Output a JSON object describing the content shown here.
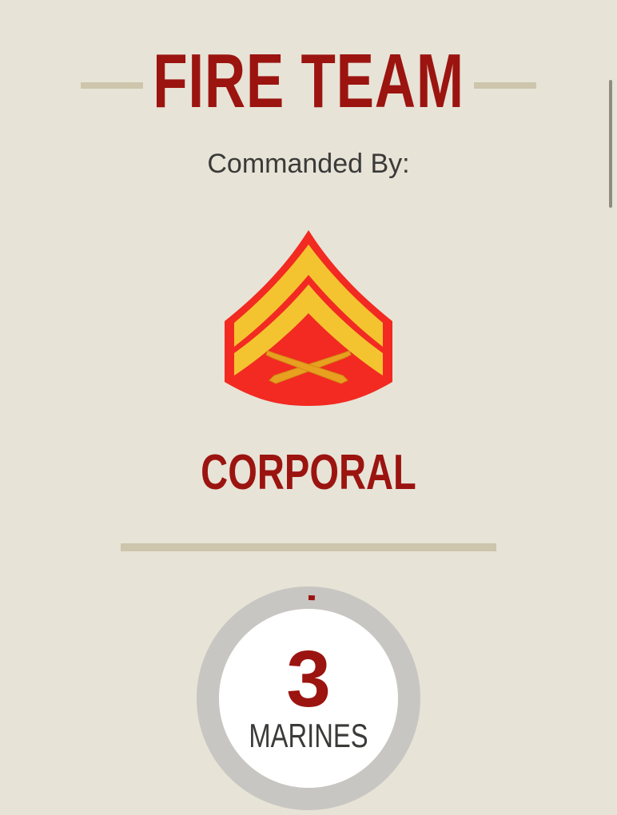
{
  "header": {
    "title": "FIRE TEAM",
    "subtitle": "Commanded By:"
  },
  "insignia": {
    "icon": "corporal-chevron-insignia-icon",
    "colors": {
      "background": "#f22a22",
      "chevrons": "#f4c430",
      "rifles": "#e8a020"
    }
  },
  "rank": {
    "label": "CORPORAL"
  },
  "strength": {
    "value": "3",
    "unit_label": "MARINES",
    "progress_fraction": 0.01
  },
  "colors": {
    "background": "#e7e3d7",
    "accent": "#9b1410",
    "rule": "#cdc5ac",
    "ring": "#c8c6c2",
    "text": "#3a3a38"
  }
}
